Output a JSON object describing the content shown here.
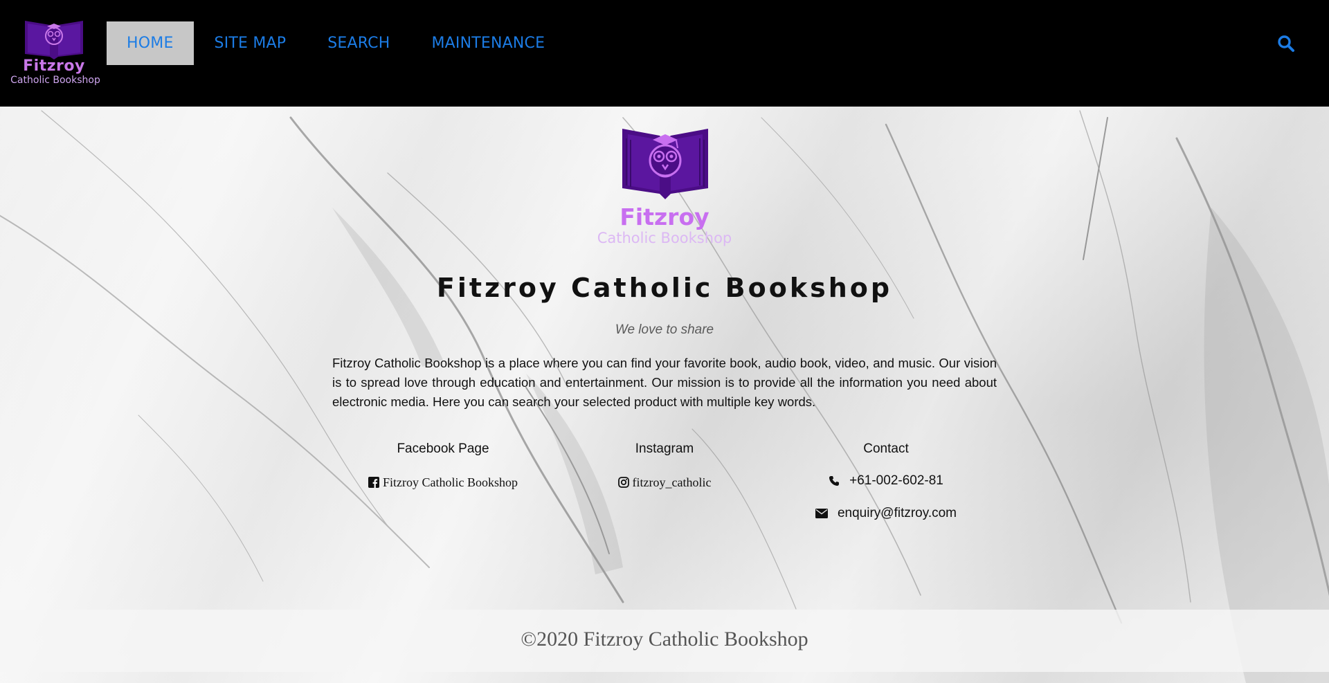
{
  "nav": {
    "logo_word": "Fitzroy",
    "logo_sub": "Catholic Bookshop",
    "items": [
      {
        "label": "HOME",
        "active": true
      },
      {
        "label": "SITE MAP"
      },
      {
        "label": "SEARCH"
      },
      {
        "label": "MAINTENANCE"
      }
    ],
    "search_icon": "search-icon"
  },
  "hero": {
    "logo_word": "Fitzroy",
    "logo_sub": "Catholic Bookshop",
    "title": "Fitzroy Catholic Bookshop",
    "tagline": "We love to share",
    "intro": "Fitzroy Catholic Bookshop is a place where you can find your favorite book, audio book, video, and music. Our vision is to spread love through education and entertainment. Our mission is to provide all the information you need about electronic media. Here you can search your selected product with multiple key words."
  },
  "links": {
    "facebook": {
      "title": "Facebook Page",
      "text": "Fitzroy Catholic Bookshop",
      "icon": "facebook-icon"
    },
    "instagram": {
      "title": "Instagram",
      "text": "fitzroy_catholic",
      "icon": "instagram-icon"
    },
    "contact": {
      "title": "Contact",
      "phone": "+61-002-602-81",
      "email": "enquiry@fitzroy.com",
      "phone_icon": "phone-icon",
      "email_icon": "envelope-icon"
    }
  },
  "footer": {
    "copyright": "©2020 Fitzroy Catholic Bookshop"
  },
  "colors": {
    "nav_bg": "#000000",
    "nav_link": "#1c7ce5",
    "active_bg": "#c7c7c7",
    "brand_purple": "#4b0d86",
    "brand_pink": "#c86ff0"
  }
}
